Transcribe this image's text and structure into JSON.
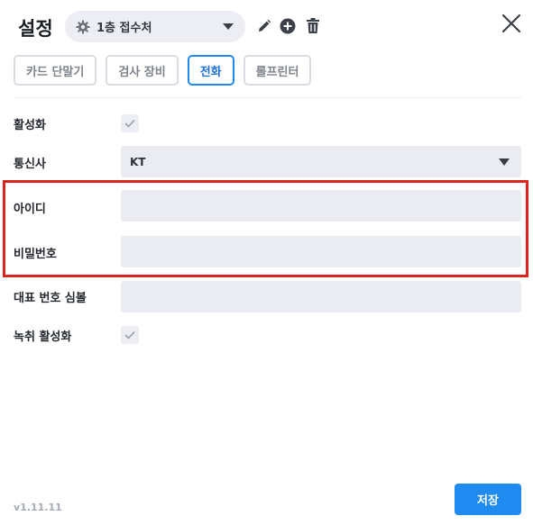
{
  "header": {
    "title": "설정",
    "branch_select": {
      "value": "1층 접수처",
      "icon": "gear-icon"
    },
    "actions": [
      "pencil-icon",
      "plus-circle-icon",
      "trash-icon"
    ],
    "close_icon": "close-icon"
  },
  "tabs": [
    {
      "label": "카드 단말기",
      "active": false
    },
    {
      "label": "검사 장비",
      "active": false
    },
    {
      "label": "전화",
      "active": true
    },
    {
      "label": "롤프린터",
      "active": false
    }
  ],
  "form": {
    "active": {
      "label": "활성화",
      "checked": true
    },
    "carrier": {
      "label": "통신사",
      "value": "KT"
    },
    "user_id": {
      "label": "아이디",
      "value": "",
      "placeholder": ""
    },
    "password": {
      "label": "비밀번호",
      "value": "",
      "placeholder": ""
    },
    "main_number": {
      "label": "대표 번호 심볼",
      "value": "",
      "placeholder": ""
    },
    "recording": {
      "label": "녹취 활성화",
      "checked": true
    }
  },
  "footer": {
    "version": "v1.11.11",
    "save_label": "저장"
  },
  "colors": {
    "accent": "#1f8bf0",
    "highlight": "#d9251d",
    "field_bg": "#eaecf2"
  }
}
